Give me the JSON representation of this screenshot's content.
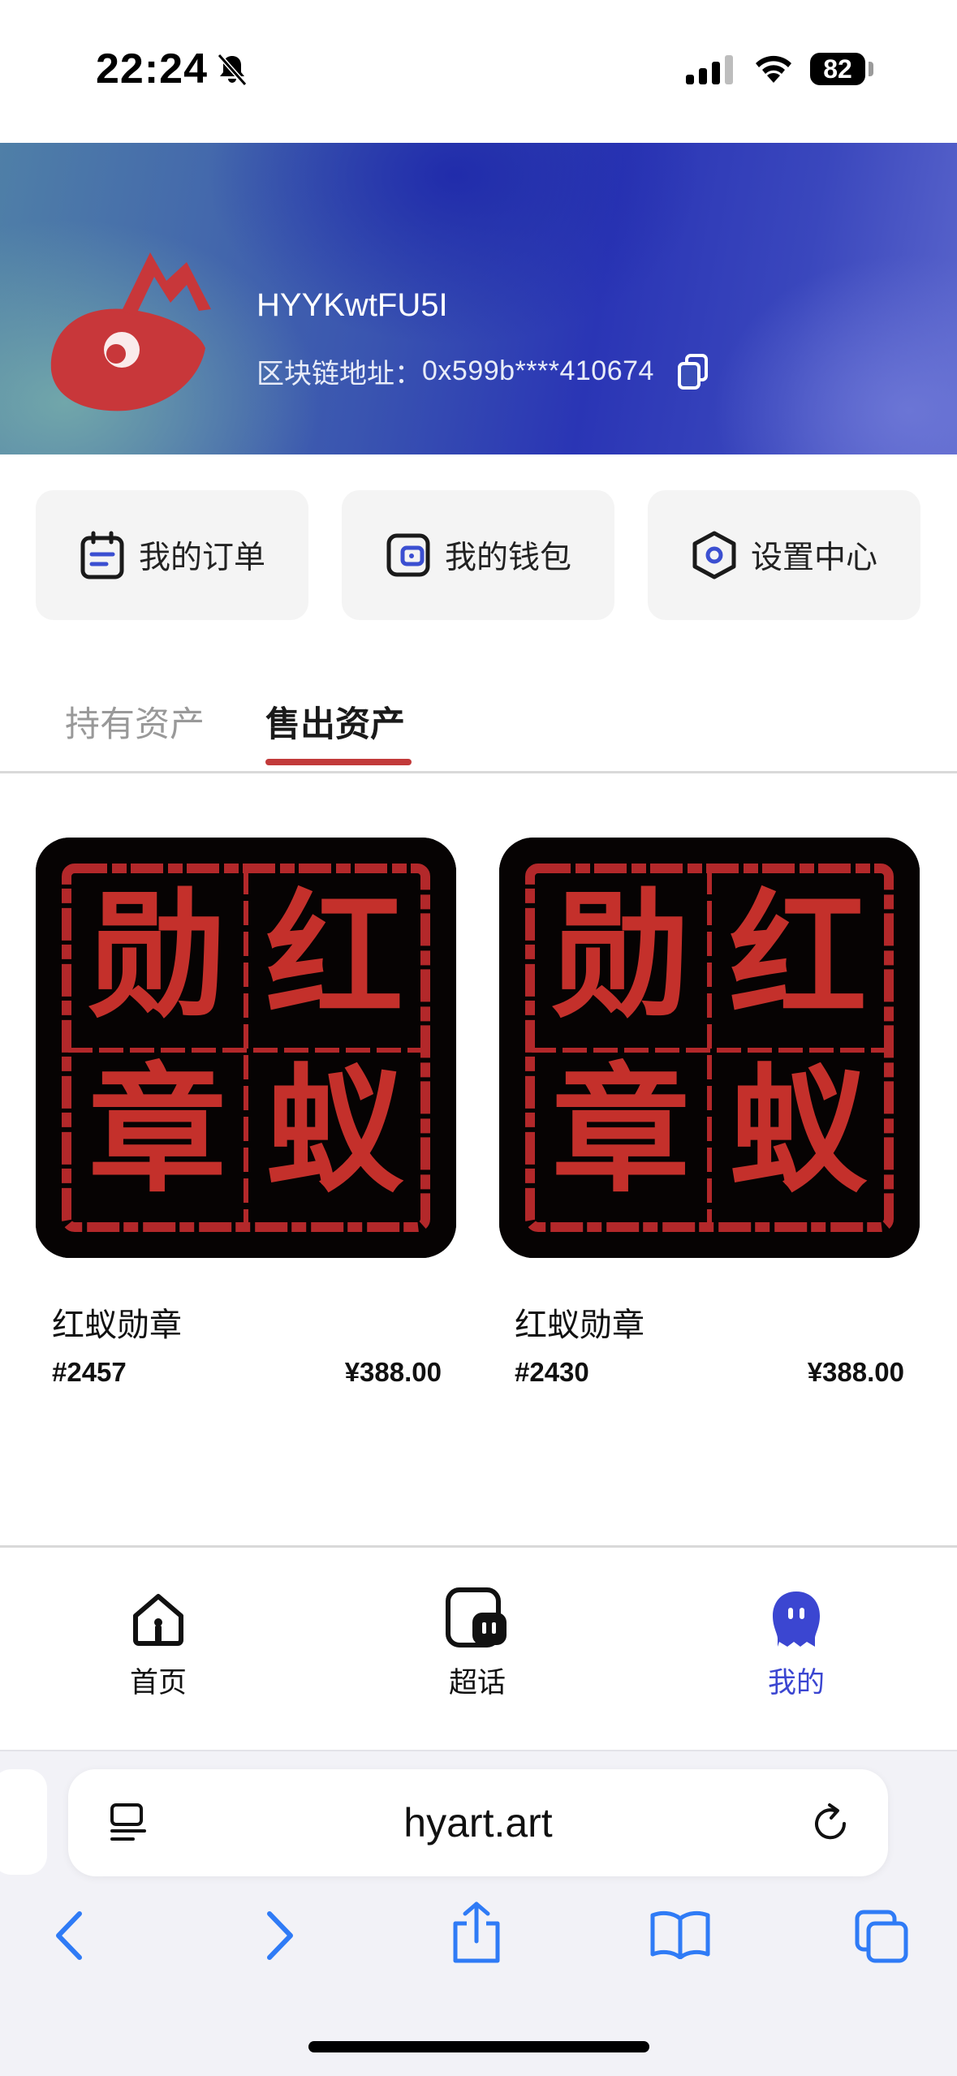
{
  "status_bar": {
    "time": "22:24",
    "battery": "82"
  },
  "profile": {
    "username": "HYYKwtFU5I",
    "address_label": "区块链地址：",
    "address_value": "0x599b****410674"
  },
  "quick_actions": [
    {
      "label": "我的订单",
      "icon": "order-icon"
    },
    {
      "label": "我的钱包",
      "icon": "wallet-icon"
    },
    {
      "label": "设置中心",
      "icon": "settings-icon"
    }
  ],
  "tabs": [
    {
      "label": "持有资产",
      "active": false
    },
    {
      "label": "售出资产",
      "active": true
    }
  ],
  "products": [
    {
      "name": "红蚁勋章",
      "id": "#2457",
      "price": "¥388.00",
      "seal_chars": [
        "勋",
        "红",
        "章",
        "蚁"
      ]
    },
    {
      "name": "红蚁勋章",
      "id": "#2430",
      "price": "¥388.00",
      "seal_chars": [
        "勋",
        "红",
        "章",
        "蚁"
      ]
    }
  ],
  "bottom_nav": [
    {
      "label": "首页",
      "icon": "home-icon",
      "active": false
    },
    {
      "label": "超话",
      "icon": "chat-icon",
      "active": false
    },
    {
      "label": "我的",
      "icon": "profile-icon",
      "active": true
    }
  ],
  "browser": {
    "url": "hyart.art"
  },
  "colors": {
    "accent_red": "#c23a3a",
    "active_nav": "#3b46d1",
    "safari_blue": "#2f7bf6"
  }
}
